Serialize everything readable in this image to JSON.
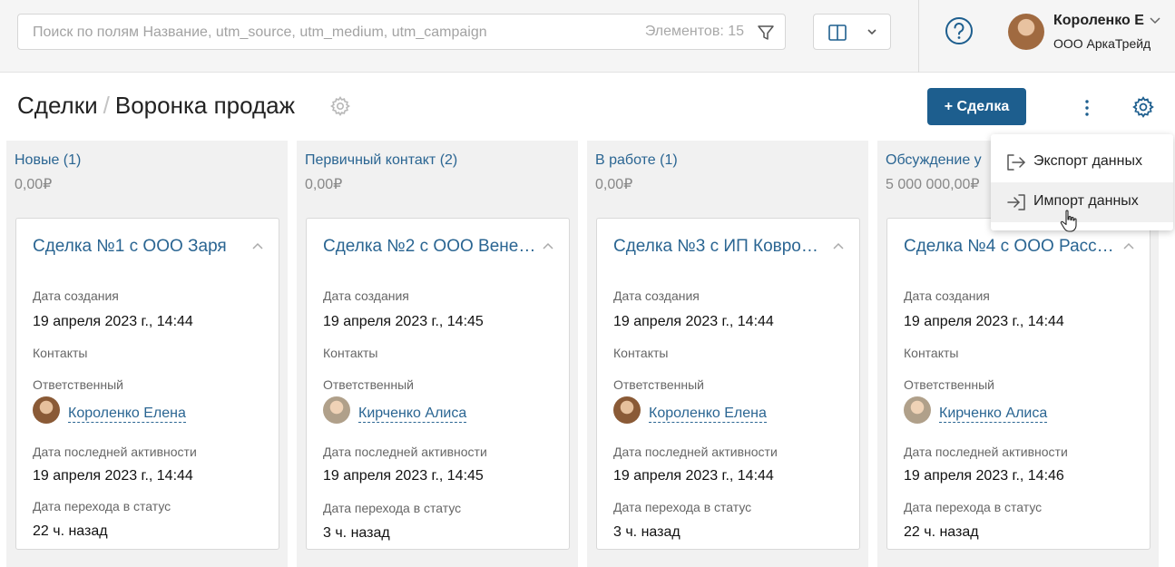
{
  "search": {
    "placeholder": "Поиск по полям Название, utm_source, utm_medium, utm_campaign",
    "count_text": "Элементов: 15"
  },
  "user": {
    "name": "Короленко Е",
    "company": "ООО АркаТрейд"
  },
  "breadcrumb": {
    "section": "Сделки",
    "separator": "/",
    "page": "Воронка продаж"
  },
  "toolbar": {
    "add_label": "+ Сделка"
  },
  "menu": {
    "items": [
      {
        "label": "Экспорт данных",
        "icon": "export-icon"
      },
      {
        "label": "Импорт данных",
        "icon": "import-icon"
      }
    ]
  },
  "field_labels": {
    "created": "Дата создания",
    "contacts": "Контакты",
    "responsible": "Ответственный",
    "last_activity": "Дата последней активности",
    "status_change": "Дата перехода в статус"
  },
  "columns": [
    {
      "title": "Новые (1)",
      "sum": "0,00₽",
      "card": {
        "title": "Сделка №1 с ООО Заря",
        "created": "19 апреля 2023 г., 14:44",
        "responsible": "Короленко Елена",
        "last_activity": "19 апреля 2023 г., 14:44",
        "status_change": "22 ч. назад"
      }
    },
    {
      "title": "Первичный контакт (2)",
      "sum": "0,00₽",
      "card": {
        "title": "Сделка №2 с ООО Вене…",
        "created": "19 апреля 2023 г., 14:45",
        "responsible": "Кирченко Алиса",
        "last_activity": "19 апреля 2023 г., 14:45",
        "status_change": "3 ч. назад"
      }
    },
    {
      "title": "В работе (1)",
      "sum": "0,00₽",
      "card": {
        "title": "Сделка №3 с ИП Ковро…",
        "created": "19 апреля 2023 г., 14:44",
        "responsible": "Короленко Елена",
        "last_activity": "19 апреля 2023 г., 14:44",
        "status_change": "3 ч. назад"
      }
    },
    {
      "title": "Обсуждение у",
      "sum": "5 000 000,00₽",
      "card": {
        "title": "Сделка №4 с ООО Расс…",
        "created": "19 апреля 2023 г., 14:44",
        "responsible": "Кирченко Алиса",
        "last_activity": "19 апреля 2023 г., 14:46",
        "status_change": "22 ч. назад"
      }
    }
  ],
  "colors": {
    "accent": "#1d5e8e",
    "link": "#2a6592"
  }
}
